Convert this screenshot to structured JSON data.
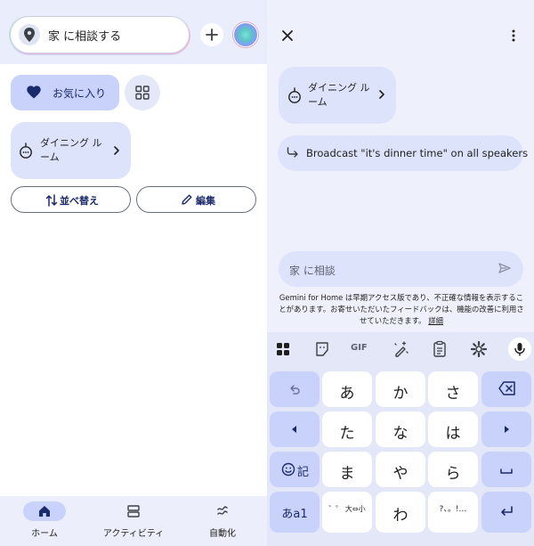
{
  "left": {
    "search": {
      "placeholder": "家 に相談する"
    },
    "favorites_label": "お気に入り",
    "room_card": {
      "label": "ダイニング ルーム"
    },
    "sort_label": "並べ替え",
    "edit_label": "編集",
    "nav": [
      {
        "label": "ホーム",
        "icon": "home-icon"
      },
      {
        "label": "アクティビティ",
        "icon": "activity-icon"
      },
      {
        "label": "自動化",
        "icon": "automation-icon"
      }
    ]
  },
  "right": {
    "room_card": {
      "label": "ダイニング ルーム"
    },
    "suggestion": "Broadcast \"it's dinner time\" on all speakers",
    "input_placeholder": "家 に相談",
    "disclaimer": "Gemini for Home は早期アクセス版であり、不正確な情報を表示することがあります。お寄せいただいたフィードバックは、機能の改善に利用させていただきます。",
    "disclaimer_link": "詳細",
    "toolbar_gif": "GIF",
    "keyboard": {
      "row1": [
        "あ",
        "か",
        "さ"
      ],
      "row2": [
        "た",
        "な",
        "は"
      ],
      "row3": [
        "ま",
        "や",
        "ら"
      ],
      "row4": [
        "わ"
      ],
      "kana_toggle": "あa1",
      "emoji_key": "記",
      "small_kana_key": "゛゜ 大⇔小",
      "punct_key": "?、。!…"
    }
  },
  "colors": {
    "accent": "#c8d2fb",
    "card": "#dde3fb",
    "header_bg": "#e9edfc",
    "nav_bg": "#eceffb",
    "text_dark_blue": "#1b2a6b"
  }
}
